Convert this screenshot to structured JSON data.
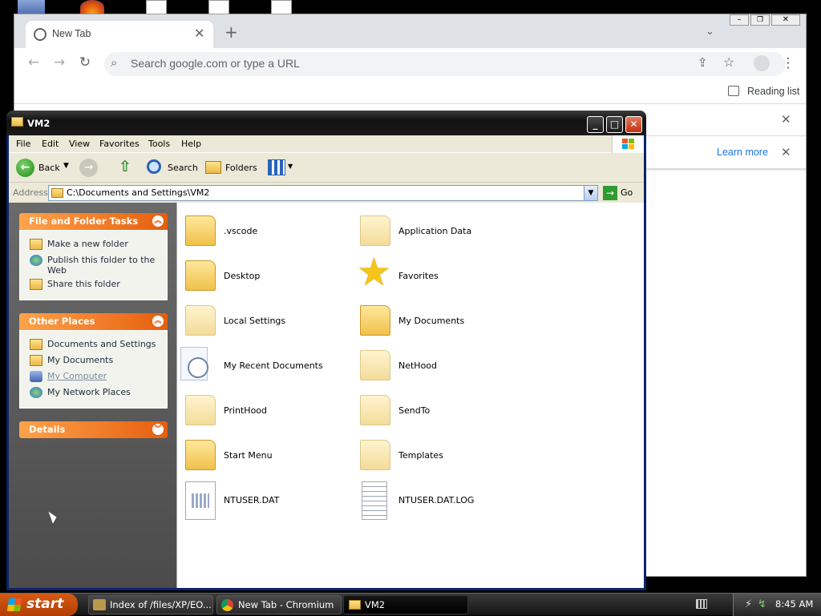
{
  "chrome": {
    "tab_title": "New Tab",
    "omnibox_placeholder": "Search google.com or type a URL",
    "reading_list": "Reading list",
    "learn_more": "Learn more"
  },
  "explorer": {
    "title": "VM2",
    "menu": [
      "File",
      "Edit",
      "View",
      "Favorites",
      "Tools",
      "Help"
    ],
    "toolbar": {
      "back": "Back",
      "search": "Search",
      "folders": "Folders"
    },
    "address_label": "Address",
    "address_value": "C:\\Documents and Settings\\VM2",
    "go": "Go",
    "tasks_title": "File and Folder Tasks",
    "tasks": [
      "Make a new folder",
      "Publish this folder to the Web",
      "Share this folder"
    ],
    "other_title": "Other Places",
    "other": [
      "Documents and Settings",
      "My Documents",
      "My Computer",
      "My Network Places"
    ],
    "details_title": "Details",
    "files": [
      ".vscode",
      "Application Data",
      "Desktop",
      "Favorites",
      "Local Settings",
      "My Documents",
      "My Recent Documents",
      "NetHood",
      "PrintHood",
      "SendTo",
      "Start Menu",
      "Templates",
      "NTUSER.DAT",
      "NTUSER.DAT.LOG"
    ]
  },
  "taskbar": {
    "start": "start",
    "items": [
      "Index of /files/XP/EO...",
      "New Tab - Chromium",
      "VM2"
    ],
    "clock": "8:45 AM"
  }
}
